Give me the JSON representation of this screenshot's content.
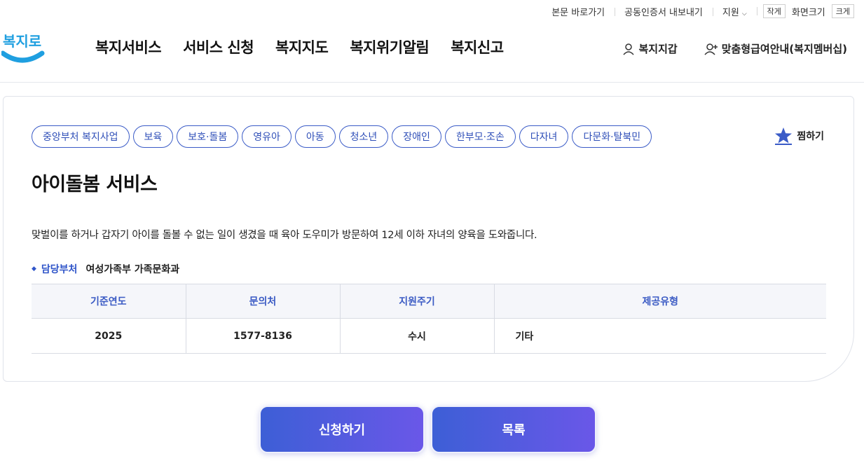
{
  "util": {
    "skip_link": "본문 바로가기",
    "cert_export": "공동인증서 내보내기",
    "support": "지원",
    "font_small": "작게",
    "font_label": "화면크기",
    "font_large": "크게"
  },
  "logo": {
    "text": "복지로",
    "icon": "bokjiro-logo"
  },
  "gnb": [
    "복지서비스",
    "서비스 신청",
    "복지지도",
    "복지위기알림",
    "복지신고"
  ],
  "header_right": {
    "wallet": "복지지갑",
    "wallet_icon": "user-icon",
    "membership": "맞춤형급여안내(복지멤버십)",
    "membership_icon": "user-plus-icon"
  },
  "tags": [
    "중앙부처 복지사업",
    "보육",
    "보호·돌봄",
    "영유아",
    "아동",
    "청소년",
    "장애인",
    "한부모·조손",
    "다자녀",
    "다문화·탈북민"
  ],
  "favorite": {
    "label": "찜하기",
    "icon": "star-icon"
  },
  "service": {
    "title": "아이돌봄 서비스",
    "description": "맞벌이를 하거나 갑자기 아이를 돌볼 수 없는 일이 생겼을 때 육아 도우미가 방문하여 12세 이하 자녀의 양육을 도와줍니다.",
    "dept_label": "담당부처",
    "dept_value": "여성가족부 가족문화과"
  },
  "table": {
    "headers": [
      "기준연도",
      "문의처",
      "지원주기",
      "제공유형"
    ],
    "row": [
      "2025",
      "1577-8136",
      "수시",
      "기타"
    ]
  },
  "buttons": {
    "apply": "신청하기",
    "list": "목록"
  },
  "colors": {
    "accent": "#3a5bc7",
    "gradient_start": "#3d5fd6",
    "gradient_end": "#6a57e8",
    "logo_blue": "#1f9fe0"
  }
}
